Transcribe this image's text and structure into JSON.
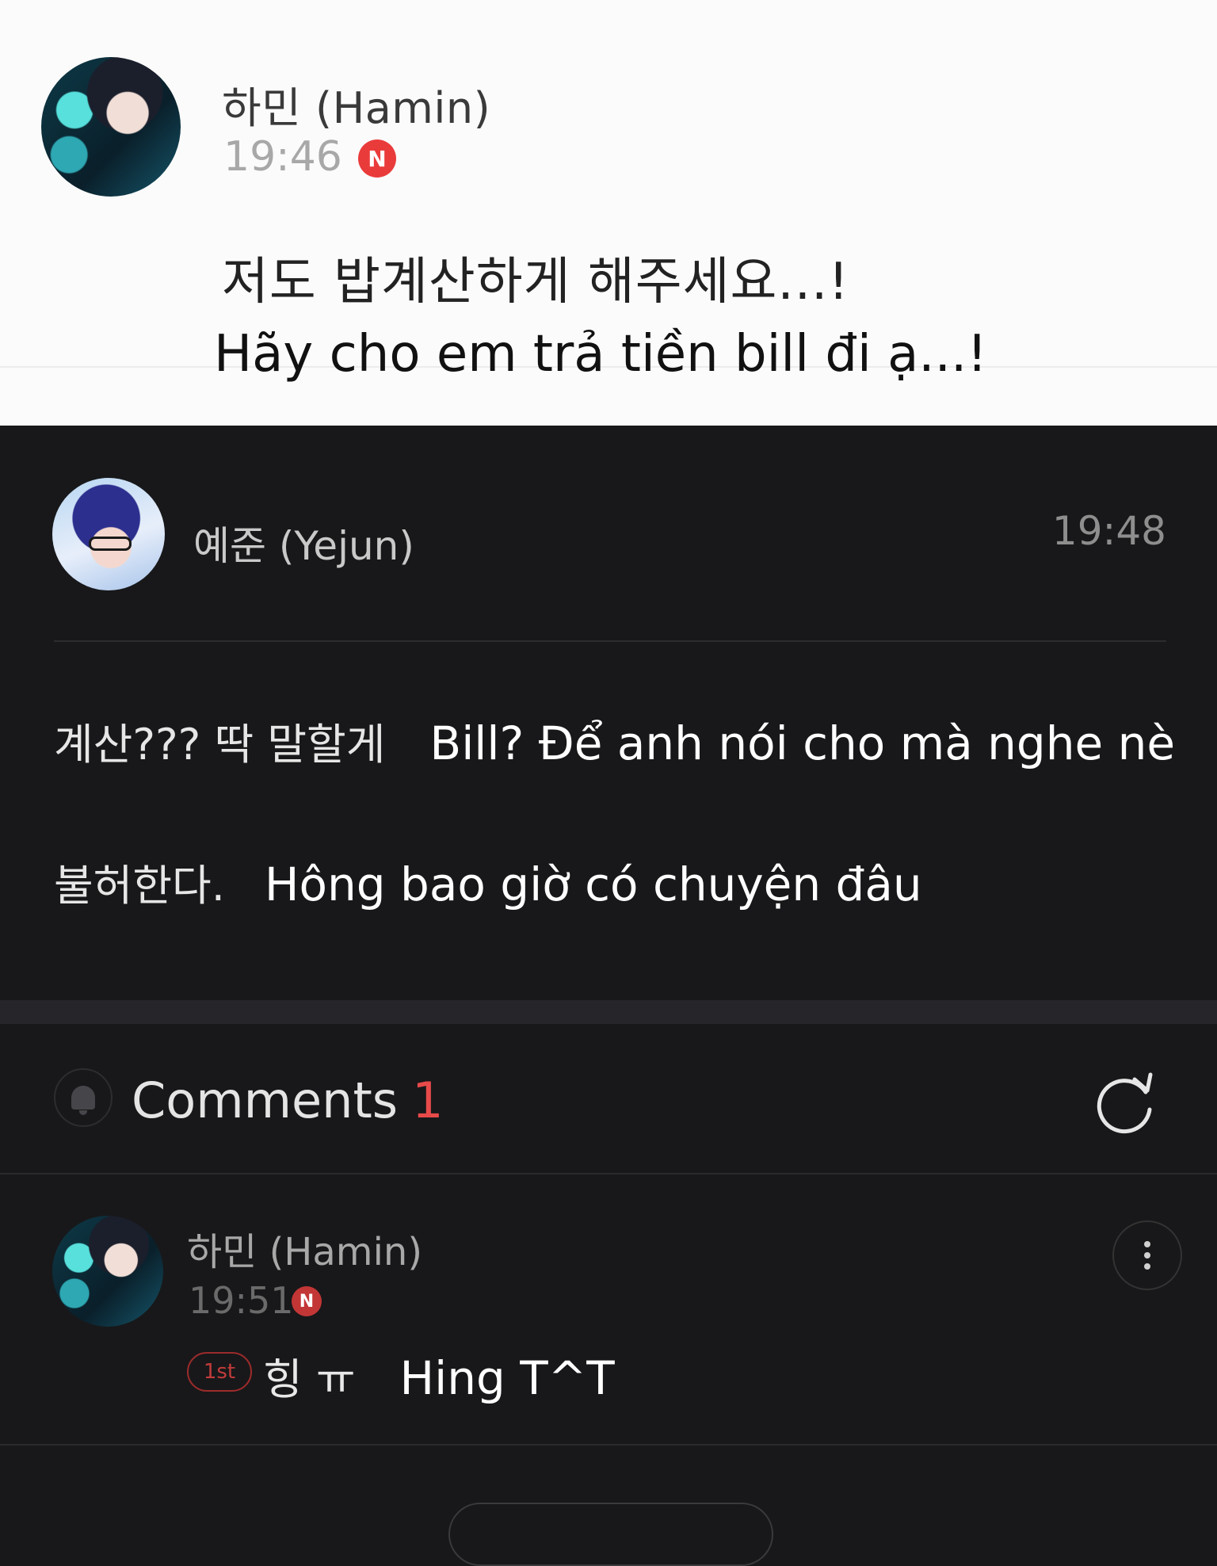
{
  "top_post": {
    "author": "하민 (Hamin)",
    "time": "19:46",
    "new_badge": "N",
    "text_ko": "저도 밥계산하게 해주세요...!",
    "text_vi": "Hãy cho em trả tiền bill đi ạ...!"
  },
  "reply_post": {
    "author": "예준 (Yejun)",
    "time": "19:48",
    "line1_ko": "계산??? 딱 말할게",
    "line1_vi": "Bill? Để anh nói cho mà nghe nè",
    "line2_ko": "불허한다.",
    "line2_vi": "Hông bao giờ có chuyện đâu"
  },
  "comments": {
    "title": "Comments",
    "count": "1",
    "items": [
      {
        "author": "하민 (Hamin)",
        "time": "19:51",
        "new_badge": "N",
        "rank_badge": "1st",
        "text_ko": "힝 ㅠ",
        "text_vi": "Hing T^T"
      }
    ]
  },
  "colors": {
    "accent_red": "#e84a4a",
    "dark_bg": "#18181a",
    "light_bg": "#fbfbfb"
  },
  "icons": [
    "bell-icon",
    "refresh-icon",
    "more-options-icon"
  ]
}
